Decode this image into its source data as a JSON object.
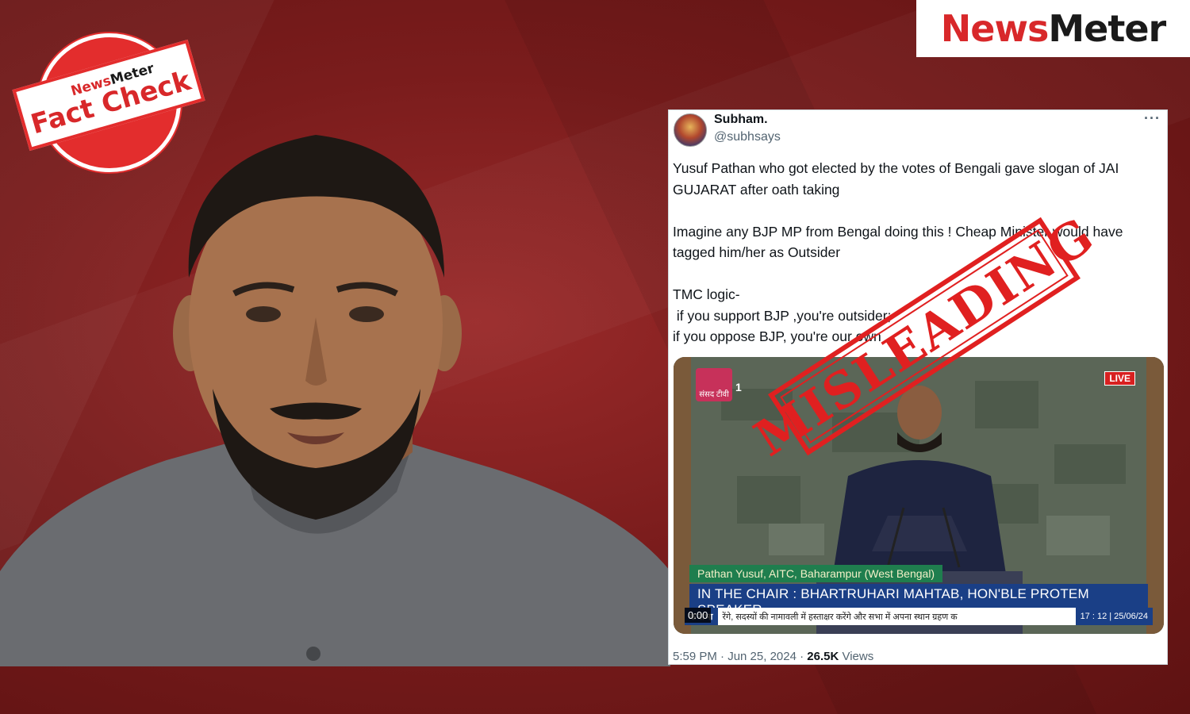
{
  "brand": {
    "news": "News",
    "meter": "Meter",
    "accent": "#d8282a"
  },
  "badge": {
    "brand_news": "News",
    "brand_meter": "Meter",
    "title": "Fact Check"
  },
  "tweet": {
    "author": "Subham.",
    "handle": "@subhsays",
    "more_icon": "more-dots-icon",
    "lines": [
      "Yusuf Pathan who got elected by the votes of Bengali gave slogan of JAI GUJARAT after oath taking",
      "",
      "Imagine any BJP MP from Bengal doing this ! Cheap Minister would have tagged him/her as Outsider",
      "",
      "TMC logic-",
      " if you support BJP ,you're outsider;",
      "if you oppose BJP, you're our own"
    ],
    "time": "5:59 PM · Jun 25, 2024 · ",
    "views_count": "26.5K",
    "views_label": " Views"
  },
  "video": {
    "channel_label": "संसद टीवी",
    "channel_number": "1",
    "live": "LIVE",
    "name_strap": "Pathan Yusuf, AITC, Baharampur (West Bengal)",
    "chair_strap": "IN THE CHAIR : BHARTRUHARI MAHTAB, HON'BLE PROTEM SPEAKER",
    "ticker_label": "क सभा",
    "ticker_text": "रेंगे, सदस्यों की नामावली में हस्ताक्षर करेंगे और सभा में अपना स्थान ग्रहण क",
    "ticker_time": "17 : 12 | 25/06/24",
    "timestamp": "0:00"
  },
  "stamp": {
    "text": "MISLEADING",
    "color": "#e02020"
  }
}
